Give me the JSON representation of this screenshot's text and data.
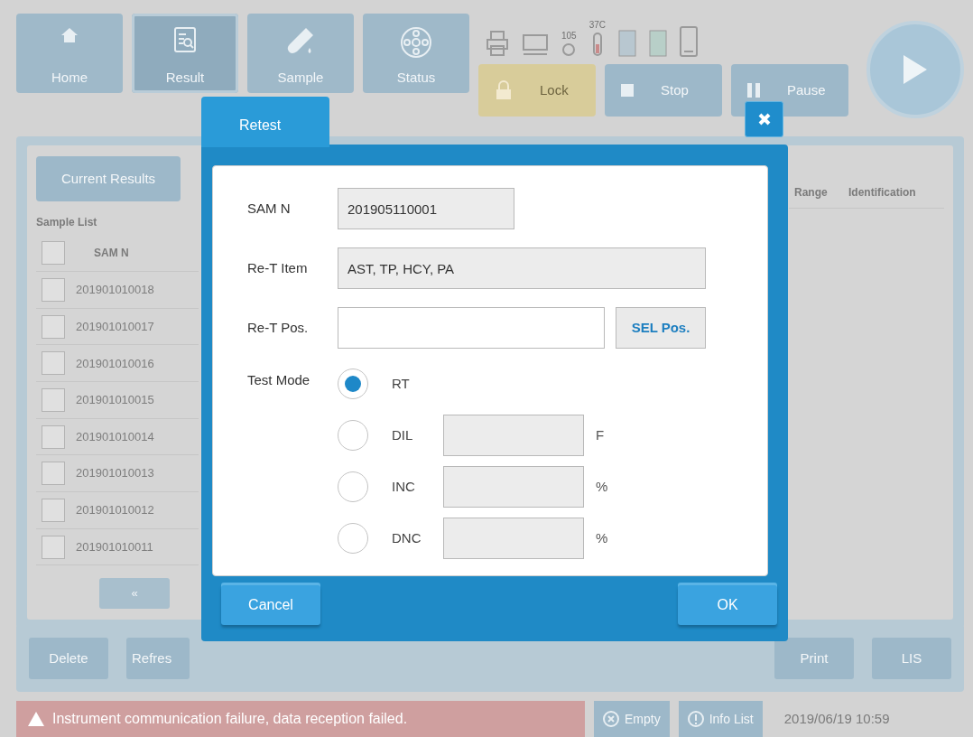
{
  "toolbar": {
    "nav": [
      {
        "label": "Home",
        "selected": false
      },
      {
        "label": "Result",
        "selected": true
      },
      {
        "label": "Sample",
        "selected": false
      },
      {
        "label": "Status",
        "selected": false
      }
    ],
    "indicators": [
      {
        "kind": "icon"
      },
      {
        "kind": "icon"
      },
      {
        "kind": "gauge",
        "caption": "105"
      },
      {
        "kind": "gauge",
        "caption": "37C"
      },
      {
        "kind": "icon"
      },
      {
        "kind": "icon"
      },
      {
        "kind": "icon"
      }
    ],
    "actions": [
      {
        "label": "Lock",
        "kind": "lock"
      },
      {
        "label": "Stop",
        "kind": "stop"
      },
      {
        "label": "Pause",
        "kind": "pause"
      }
    ]
  },
  "results_panel": {
    "tab": "Current Results",
    "list_title": "Sample List",
    "column": "SAM N",
    "select_all_checked": false,
    "rows": [
      {
        "sample": "201901010018",
        "checked": false
      },
      {
        "sample": "201901010017",
        "checked": false
      },
      {
        "sample": "201901010016",
        "checked": false
      },
      {
        "sample": "201901010015",
        "checked": false
      },
      {
        "sample": "201901010014",
        "checked": false
      },
      {
        "sample": "201901010013",
        "checked": false
      },
      {
        "sample": "201901010012",
        "checked": false
      },
      {
        "sample": "201901010011",
        "checked": false
      }
    ],
    "right_columns": [
      "Range",
      "Identification"
    ],
    "pager": "«"
  },
  "bottom_buttons_left": [
    "Delete",
    "Refres"
  ],
  "bottom_buttons_right": [
    "Print",
    "LIS"
  ],
  "status_bar": {
    "message": "Instrument communication failure, data reception failed.",
    "buttons": [
      "Empty",
      "Info List"
    ],
    "datetime": "2019/06/19 10:59"
  },
  "dialog": {
    "title": "Retest",
    "fields": [
      {
        "label": "SAM N",
        "value": "201905110001"
      },
      {
        "label": "Re-T Item",
        "value": "AST, TP, HCY, PA"
      }
    ],
    "position": {
      "label": "Re-T Pos.",
      "button": "SEL Pos."
    },
    "test_mode": {
      "label": "Test Mode",
      "options": [
        {
          "label": "RT",
          "selected": true
        },
        {
          "label": "DIL",
          "selected": false,
          "unit": "F"
        },
        {
          "label": "INC",
          "selected": false,
          "unit": "%"
        },
        {
          "label": "DNC",
          "selected": false,
          "unit": "%"
        }
      ]
    },
    "cancel": "Cancel",
    "ok": "OK"
  }
}
